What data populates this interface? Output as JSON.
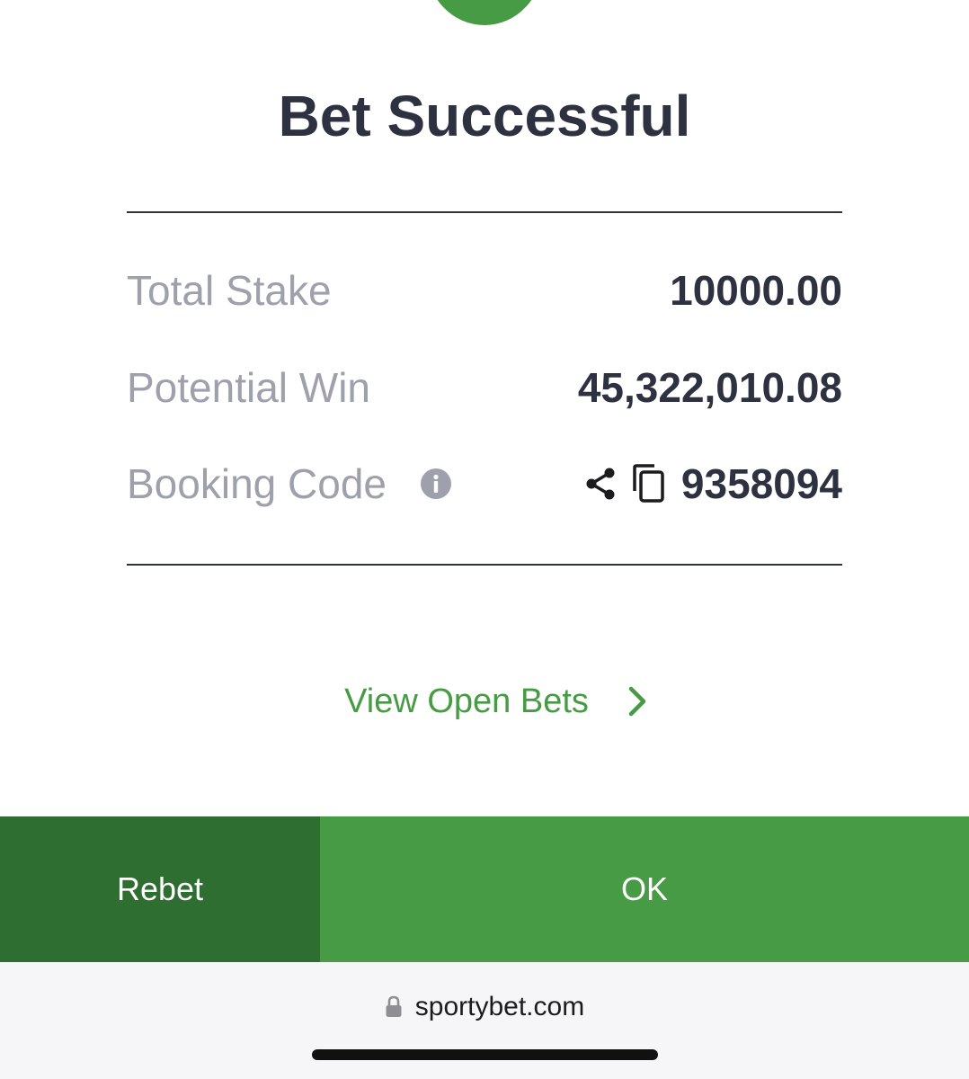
{
  "title": "Bet Successful",
  "details": {
    "total_stake": {
      "label": "Total Stake",
      "value": "10000.00"
    },
    "potential_win": {
      "label": "Potential Win",
      "value": "45,322,010.08"
    },
    "booking_code": {
      "label": "Booking Code",
      "value": "9358094"
    }
  },
  "links": {
    "view_open_bets": "View Open Bets"
  },
  "buttons": {
    "rebet": "Rebet",
    "ok": "OK"
  },
  "browser": {
    "url": "sportybet.com"
  },
  "colors": {
    "brand_green": "#469b44",
    "dark_green": "#2e6e30",
    "text_dark": "#2e3240",
    "text_muted": "#9ea1ab"
  },
  "icons": [
    "success-icon",
    "info-icon",
    "share-icon",
    "copy-icon",
    "chevron-right-icon",
    "lock-icon"
  ]
}
